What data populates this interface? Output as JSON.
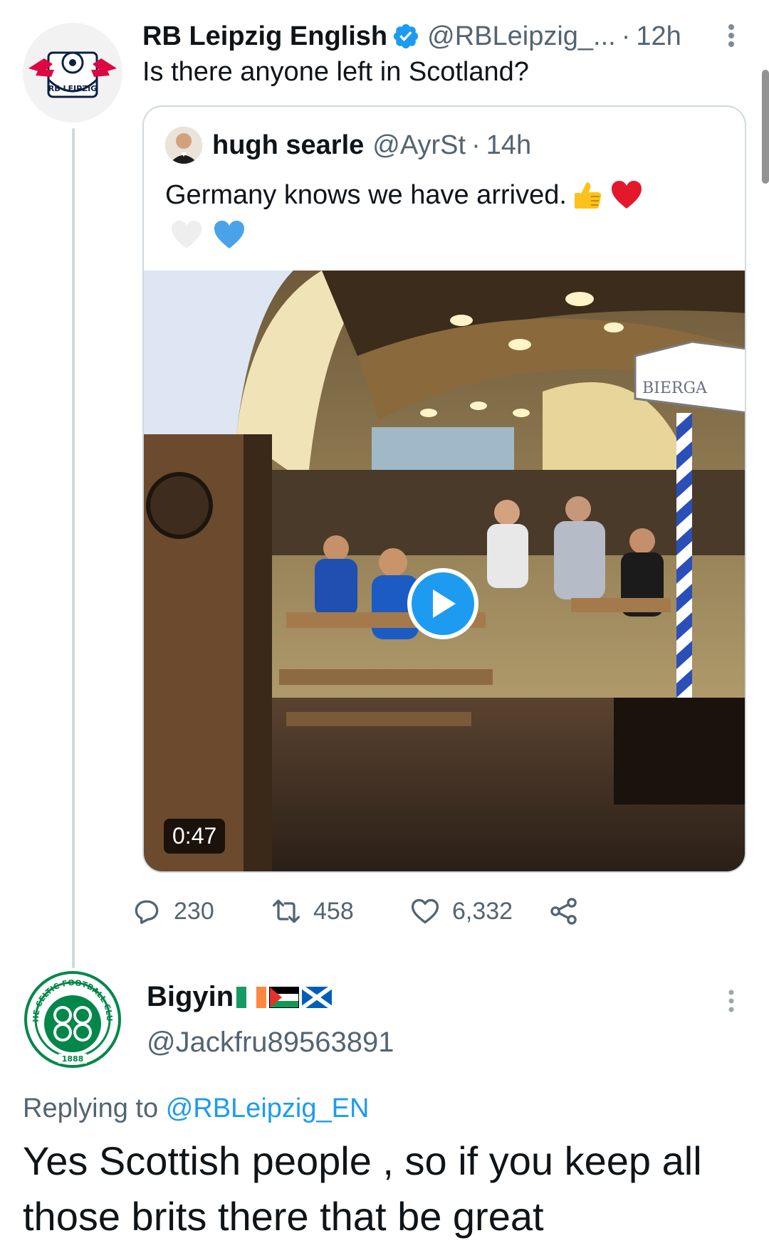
{
  "tweet": {
    "author_name": "RB Leipzig English",
    "author_handle": "@RBLeipzig_...",
    "dot": "·",
    "time": "12h",
    "text": "Is there anyone left in Scotland?",
    "avatar_icon": "rb-leipzig-logo-icon"
  },
  "quoted": {
    "author_name": "hugh searle",
    "author_handle": "@AyrSt",
    "dot": "·",
    "time": "14h",
    "text": "Germany knows we have arrived.",
    "emojis": [
      "thumbs-up-icon",
      "red-heart-icon",
      "white-heart-icon",
      "blue-heart-icon"
    ],
    "video": {
      "duration": "0:47",
      "sign_text": "BIERGA"
    }
  },
  "actions": {
    "replies": "230",
    "retweets": "458",
    "likes": "6,332"
  },
  "reply": {
    "author_name": "Bigyin",
    "flags": [
      "ireland-flag-icon",
      "palestine-flag-icon",
      "scotland-flag-icon"
    ],
    "author_handle": "@Jackfru89563891",
    "replying_prefix": "Replying to",
    "replying_to": "@RBLeipzig_EN",
    "text": "Yes Scottish people , so if you keep all those brits there that be great",
    "avatar_icon": "celtic-fc-crest-icon",
    "crest_top_text": "THE CELTIC FOOTBALL CLUB",
    "crest_year": "1888"
  },
  "colors": {
    "accent": "#1d9bf0",
    "secondary_text": "#536471",
    "border": "#cfd9de",
    "celtic_green": "#018749",
    "leipzig_red": "#dd0741"
  }
}
